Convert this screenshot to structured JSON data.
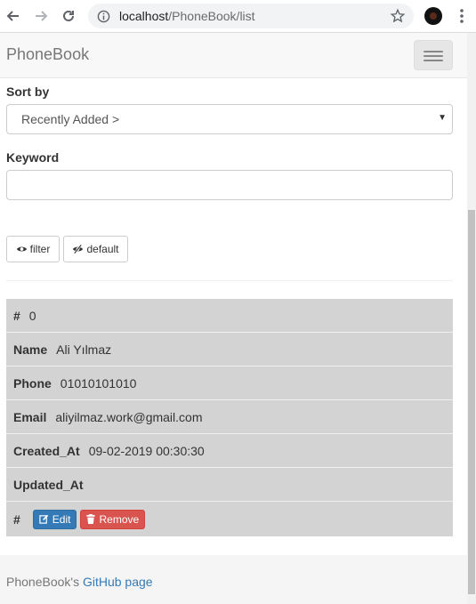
{
  "browser": {
    "url_host": "localhost",
    "url_path": "/PhoneBook/list"
  },
  "navbar": {
    "brand": "PhoneBook"
  },
  "form": {
    "sort_label": "Sort by",
    "sort_selected": "Recently Added >",
    "keyword_label": "Keyword",
    "keyword_value": "",
    "keyword_placeholder": "",
    "filter_label": "filter",
    "default_label": "default"
  },
  "record": {
    "id_key": "#",
    "id_value": "0",
    "name_key": "Name",
    "name_value": "Ali Yılmaz",
    "phone_key": "Phone",
    "phone_value": "01010101010",
    "email_key": "Email",
    "email_value": "aliyilmaz.work@gmail.com",
    "created_key": "Created_At",
    "created_value": "09-02-2019 00:30:30",
    "updated_key": "Updated_At",
    "updated_value": "",
    "actions_key": "#",
    "edit_label": "Edit",
    "remove_label": "Remove"
  },
  "footer": {
    "prefix": "PhoneBook's ",
    "link_text": "GitHub page"
  },
  "colors": {
    "primary": "#337ab7",
    "danger": "#d9534f",
    "row_bg": "#d3d3d3"
  }
}
